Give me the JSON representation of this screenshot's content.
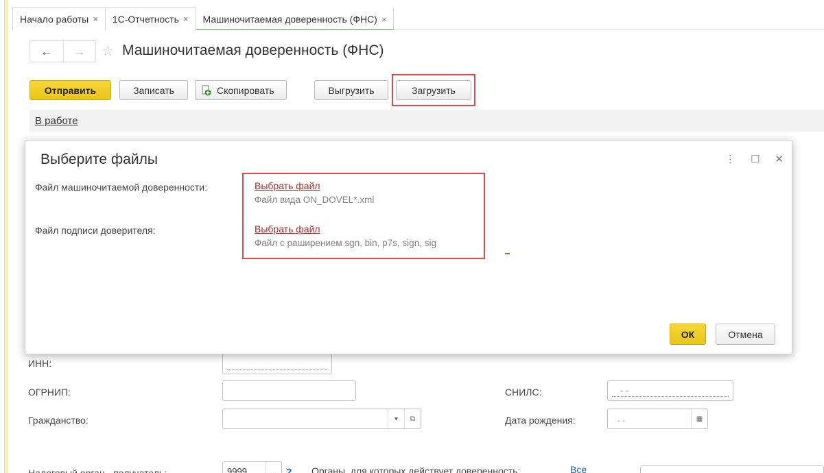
{
  "tabs": [
    {
      "label": "Начало работы"
    },
    {
      "label": "1С-Отчетность"
    },
    {
      "label": "Машиночитаемая доверенность (ФНС)"
    }
  ],
  "document": {
    "title": "Машиночитаемая доверенность (ФНС)",
    "nav_back": "←",
    "nav_forward": "→",
    "star": "☆"
  },
  "toolbar": {
    "send": "Отправить",
    "save": "Записать",
    "copy": "Скопировать",
    "export": "Выгрузить",
    "import": "Загрузить"
  },
  "status": {
    "label": "В работе"
  },
  "dialog": {
    "title": "Выберите файлы",
    "more_icon": "⋮",
    "maximize_icon": "☐",
    "close_icon": "✕",
    "rows": [
      {
        "label": "Файл машиночитаемой доверенности:",
        "link": "Выбрать файл",
        "hint": "Файл вида ON_DOVEL*.xml"
      },
      {
        "label": "Файл подписи доверителя:",
        "link": "Выбрать файл",
        "hint": "Файл с раширением sgn, bin, p7s, sign, sig"
      }
    ],
    "ok": "ОК",
    "cancel": "Отмена"
  },
  "form": {
    "inn_label": "ИНН:",
    "ogrnip_label": "ОГРНИП:",
    "snils_label": "СНИЛС:",
    "snils_value": "-  -",
    "citizenship_label": "Гражданство:",
    "birthdate_label": "Дата рождения:",
    "birthdate_value": ".  .",
    "tax_authority_label": "Налоговый орган - получатель:",
    "tax_authority_value": "9999",
    "tax_authority_help": "?",
    "authorities_label": "Органы, для которых действует доверенность:",
    "authorities_value": "Все"
  },
  "colors": {
    "primary_button": "#f0cf2c",
    "highlight_border": "#e0474c",
    "file_link": "#a82c2c",
    "active_tab_underline": "#3f9d3f"
  }
}
